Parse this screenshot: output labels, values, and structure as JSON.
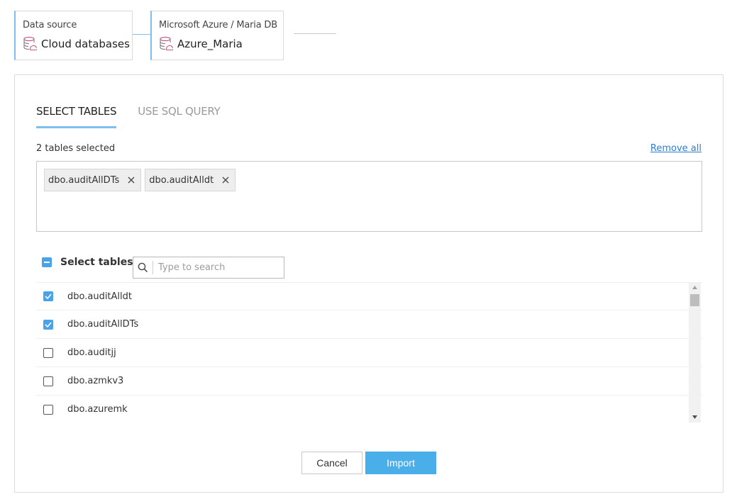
{
  "breadcrumb": {
    "step1": {
      "caption": "Data source",
      "value": "Cloud databases",
      "icon": "cloud-database-icon"
    },
    "step2": {
      "caption": "Microsoft Azure / Maria DB",
      "value": "Azure_Maria",
      "icon": "cloud-database-icon"
    }
  },
  "tabs": [
    {
      "label": "SELECT TABLES",
      "active": true
    },
    {
      "label": "USE SQL QUERY",
      "active": false
    }
  ],
  "selection": {
    "count_text": "2 tables selected",
    "remove_all_label": "Remove all",
    "chips": [
      "dbo.auditAllDTs",
      "dbo.auditAlldt"
    ]
  },
  "table_picker": {
    "header_label": "Select tables",
    "search_placeholder": "Type to search",
    "rows": [
      {
        "name": "dbo.auditAlldt",
        "checked": true
      },
      {
        "name": "dbo.auditAllDTs",
        "checked": true
      },
      {
        "name": "dbo.auditjj",
        "checked": false
      },
      {
        "name": "dbo.azmkv3",
        "checked": false
      },
      {
        "name": "dbo.azuremk",
        "checked": false
      }
    ]
  },
  "buttons": {
    "cancel_label": "Cancel",
    "import_label": "Import"
  },
  "colors": {
    "accent": "#4aa3e8",
    "tab_underline": "#7cc0ee",
    "link": "#2a7fd4",
    "import_button": "#4aaee8"
  }
}
